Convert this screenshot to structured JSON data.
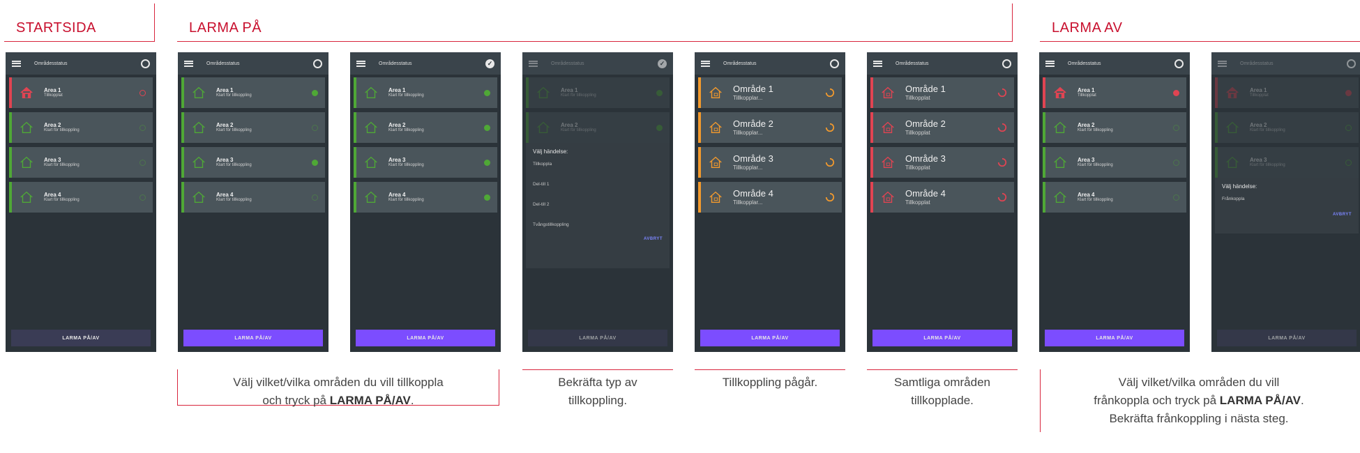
{
  "sections": {
    "start": "STARTSIDA",
    "on": "LARMA PÅ",
    "off": "LARMA AV"
  },
  "app": {
    "title": "Områdesstatus",
    "button": "LARMA PÅ/AV"
  },
  "colors": {
    "accent_red": "#c8102e",
    "green": "#4fa836",
    "red": "#e04452",
    "orange": "#f39a2d",
    "purple": "#7c4dff"
  },
  "screens": [
    {
      "cards": [
        {
          "name": "Area 1",
          "status": "Tillkopplat"
        },
        {
          "name": "Area 2",
          "status": "Klart för tillkoppling"
        },
        {
          "name": "Area 3",
          "status": "Klart för tillkoppling"
        },
        {
          "name": "Area 4",
          "status": "Klart för tillkoppling"
        }
      ]
    },
    {
      "cards": [
        {
          "name": "Area 1",
          "status": "Klart för tillkoppling"
        },
        {
          "name": "Area 2",
          "status": "Klart för tillkoppling"
        },
        {
          "name": "Area 3",
          "status": "Klart för tillkoppling"
        },
        {
          "name": "Area 4",
          "status": "Klart för tillkoppling"
        }
      ]
    },
    {
      "cards": [
        {
          "name": "Area 1",
          "status": "Klart för tillkoppling"
        },
        {
          "name": "Area 2",
          "status": "Klart för tillkoppling"
        },
        {
          "name": "Area 3",
          "status": "Klart för tillkoppling"
        },
        {
          "name": "Area 4",
          "status": "Klart för tillkoppling"
        }
      ]
    },
    {
      "cards": [
        {
          "name": "Area 1",
          "status": "Klart för tillkoppling"
        },
        {
          "name": "Area 2",
          "status": "Klart för tillkoppling"
        }
      ],
      "dialog": {
        "title": "Välj händelse:",
        "options": [
          "Tillkoppla",
          "Del-till 1",
          "Del-till 2",
          "Tvångstillkoppling"
        ],
        "cancel": "AVBRYT"
      }
    },
    {
      "cards": [
        {
          "name": "Område 1",
          "status": "Tillkopplar..."
        },
        {
          "name": "Område 2",
          "status": "Tillkopplar..."
        },
        {
          "name": "Område 3",
          "status": "Tillkopplar..."
        },
        {
          "name": "Område 4",
          "status": "Tillkopplar..."
        }
      ]
    },
    {
      "cards": [
        {
          "name": "Område 1",
          "status": "Tillkopplat"
        },
        {
          "name": "Område 2",
          "status": "Tillkopplat"
        },
        {
          "name": "Område 3",
          "status": "Tillkopplat"
        },
        {
          "name": "Område 4",
          "status": "Tillkopplat"
        }
      ]
    },
    {
      "cards": [
        {
          "name": "Area 1",
          "status": "Tillkopplat"
        },
        {
          "name": "Area 2",
          "status": "Klart för tillkoppling"
        },
        {
          "name": "Area 3",
          "status": "Klart för tillkoppling"
        },
        {
          "name": "Area 4",
          "status": "Klart för tillkoppling"
        }
      ]
    },
    {
      "cards": [
        {
          "name": "Area 1",
          "status": "Tillkopplat"
        },
        {
          "name": "Area 2",
          "status": "Klart för tillkoppling"
        },
        {
          "name": "Area 3",
          "status": "Klart för tillkoppling"
        }
      ],
      "dialog": {
        "title": "Välj händelse:",
        "options": [
          "Frånkoppla"
        ],
        "cancel": "AVBRYT"
      }
    }
  ],
  "captions": {
    "c1_a": "Välj vilket/vilka områden du vill tillkoppla",
    "c1_b": "och tryck på ",
    "c1_bold": "LARMA PÅ/AV",
    "c1_end": ".",
    "c2_a": "Bekräfta typ av",
    "c2_b": "tillkoppling.",
    "c3": "Tillkoppling pågår.",
    "c4_a": "Samtliga områden",
    "c4_b": "tillkopplade.",
    "c5_a": "Välj vilket/vilka områden du vill",
    "c5_b": "frånkoppla och tryck på ",
    "c5_bold": "LARMA PÅ/AV",
    "c5_end": ".",
    "c5_c": "Bekräfta frånkoppling i nästa steg."
  }
}
